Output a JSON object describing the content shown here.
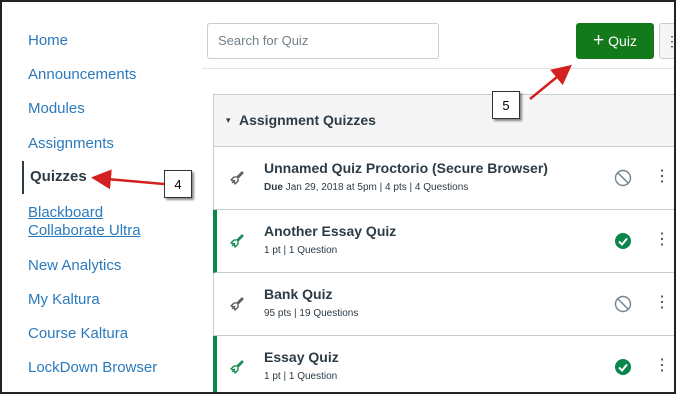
{
  "sidebar": {
    "items": [
      {
        "label": "Home"
      },
      {
        "label": "Announcements"
      },
      {
        "label": "Modules"
      },
      {
        "label": "Assignments"
      },
      {
        "label": "Quizzes"
      },
      {
        "label": "Blackboard"
      },
      {
        "label": "Collaborate Ultra"
      },
      {
        "label": "New Analytics"
      },
      {
        "label": "My Kaltura"
      },
      {
        "label": "Course Kaltura"
      },
      {
        "label": "LockDown Browser"
      }
    ]
  },
  "toolbar": {
    "search_placeholder": "Search for Quiz",
    "add_quiz_plus": "+",
    "add_quiz_label": "Quiz",
    "more_label": "⋮"
  },
  "group": {
    "caret": "▾",
    "title": "Assignment Quizzes"
  },
  "quizzes": [
    {
      "title": "Unnamed Quiz Proctorio (Secure Browser)",
      "due_label": "Due",
      "due": "Jan 29, 2018 at 5pm",
      "sep1": "|",
      "points": "4 pts",
      "sep2": "|",
      "questions": "4 Questions",
      "published": false
    },
    {
      "title": "Another Essay Quiz",
      "points": "1 pt",
      "sep": "|",
      "questions": "1 Question",
      "published": true
    },
    {
      "title": "Bank Quiz",
      "points": "95 pts",
      "sep": "|",
      "questions": "19 Questions",
      "published": false
    },
    {
      "title": "Essay Quiz",
      "points": "1 pt",
      "sep": "|",
      "questions": "1 Question",
      "published": true
    }
  ],
  "kebab": "⋮",
  "callouts": [
    {
      "label": "4"
    },
    {
      "label": "5"
    }
  ],
  "colors": {
    "link": "#2b7abc",
    "primary_button": "#127a1b",
    "published": "#0b874b",
    "annotation_arrow": "#d42020"
  }
}
